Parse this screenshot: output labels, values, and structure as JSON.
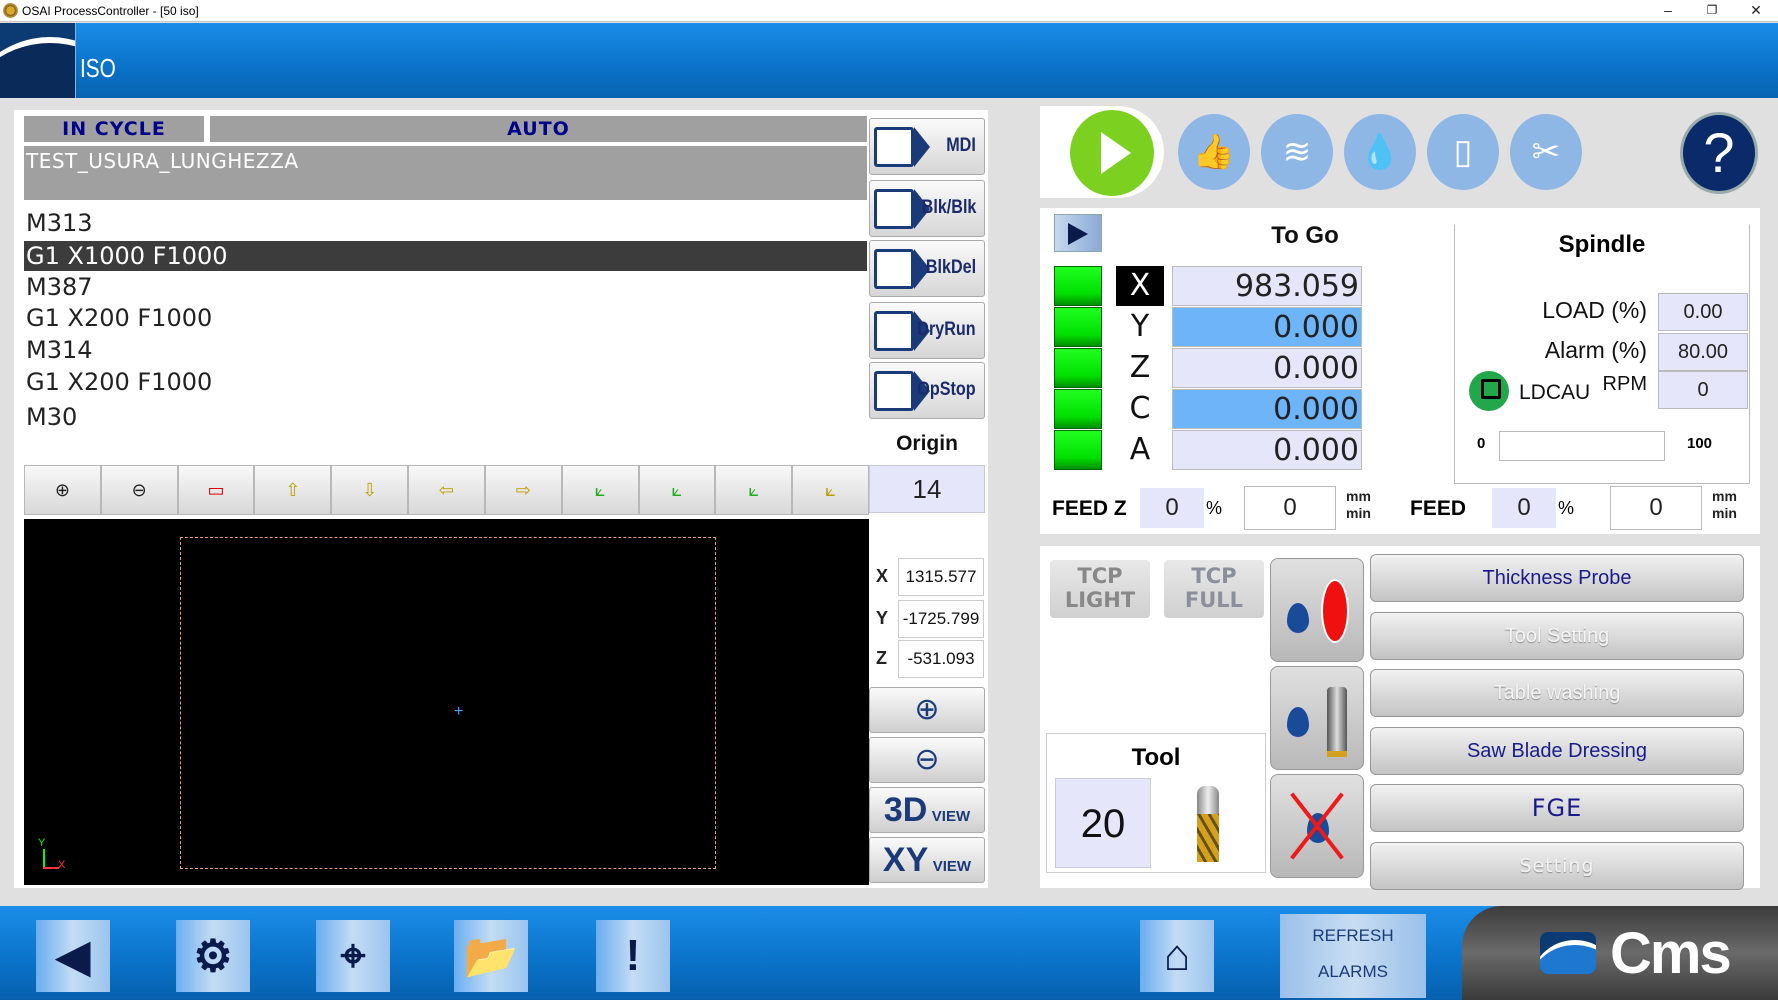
{
  "window": {
    "title": "OSAI ProcessController - [50 iso]",
    "controls": {
      "minimize": "–",
      "restore": "❐",
      "close": "✕"
    }
  },
  "header": {
    "mode_title": "ISO"
  },
  "status": {
    "cycle": "IN CYCLE",
    "mode": "AUTO"
  },
  "program": {
    "name": "TEST_USURA_LUNGHEZZA",
    "lines": [
      "M313",
      "G1 X1000 F1000",
      "M387",
      "G1 X200 F1000",
      "M314",
      "G1 X200 F1000",
      "M30"
    ],
    "selected_index": 1
  },
  "side_commands": [
    {
      "label": "MDI",
      "icon": "hand-icon"
    },
    {
      "label": "Blk/Blk",
      "icon": "block-by-block-icon"
    },
    {
      "label": "BlkDel",
      "icon": "block-delete-icon"
    },
    {
      "label": "DryRun",
      "icon": "dry-run-icon"
    },
    {
      "label": "OpStop",
      "icon": "optional-stop-icon"
    }
  ],
  "origin": {
    "label": "Origin",
    "value": "14"
  },
  "graphic_toolbar": [
    {
      "name": "zoom-in-icon",
      "glyph": "⊕"
    },
    {
      "name": "zoom-out-icon",
      "glyph": "⊖"
    },
    {
      "name": "zoom-window-icon",
      "glyph": "▭"
    },
    {
      "name": "pan-up-icon",
      "glyph": "⇧"
    },
    {
      "name": "pan-down-icon",
      "glyph": "⇩"
    },
    {
      "name": "pan-left-icon",
      "glyph": "⇦"
    },
    {
      "name": "pan-right-icon",
      "glyph": "⇨"
    },
    {
      "name": "view-xy-icon",
      "glyph": "⟀"
    },
    {
      "name": "view-xz-icon",
      "glyph": "⟀"
    },
    {
      "name": "view-yz-icon",
      "glyph": "⟀"
    },
    {
      "name": "view-iso-icon",
      "glyph": "⟀"
    }
  ],
  "graphic": {
    "axis_y": "Y",
    "axis_x": "X",
    "cursor": "+"
  },
  "coords": [
    {
      "axis": "X",
      "value": "1315.577"
    },
    {
      "axis": "Y",
      "value": "-1725.799"
    },
    {
      "axis": "Z",
      "value": "-531.093"
    }
  ],
  "view_buttons": {
    "zoom_in": "⊕",
    "zoom_out": "⊖",
    "view3d_big": "3D",
    "view3d_small": "VIEW",
    "viewxy_big": "XY",
    "viewxy_small": "VIEW"
  },
  "top_icons": {
    "play": "play-icon",
    "items": [
      {
        "name": "thumbs-up-icon",
        "glyph": "👍"
      },
      {
        "name": "air-blow-icon",
        "glyph": "≋"
      },
      {
        "name": "coolant-drop-icon",
        "glyph": "💧"
      },
      {
        "name": "door-icon",
        "glyph": "▯"
      },
      {
        "name": "tools-icon",
        "glyph": "✂"
      }
    ],
    "help": "?"
  },
  "axes": {
    "title": "To Go",
    "rows": [
      {
        "axis": "X",
        "value": "983.059",
        "active": true,
        "highlight": false
      },
      {
        "axis": "Y",
        "value": "0.000",
        "active": false,
        "highlight": true
      },
      {
        "axis": "Z",
        "value": "0.000",
        "active": false,
        "highlight": false
      },
      {
        "axis": "C",
        "value": "0.000",
        "active": false,
        "highlight": true
      },
      {
        "axis": "A",
        "value": "0.000",
        "active": false,
        "highlight": false
      }
    ],
    "status_led_color": "#00e000",
    "highlight_color": "#6eb4f8"
  },
  "spindle": {
    "title": "Spindle",
    "load_label": "LOAD (%)",
    "load_value": "0.00",
    "alarm_label": "Alarm (%)",
    "alarm_value": "80.00",
    "rpm_label": "RPM",
    "rpm_value": "0",
    "ldc_label": "LDCAU",
    "bar_min": "0",
    "bar_max": "100",
    "bar_fraction": 0
  },
  "feed": {
    "feedz_label": "FEED Z",
    "feedz_pct": "0",
    "feedz_value": "0",
    "feed_label": "FEED",
    "feed_pct": "0",
    "feed_value": "0",
    "pct_sym": "%",
    "unit_top": "mm",
    "unit_bottom": "min"
  },
  "tcp": {
    "light_1": "TCP",
    "light_2": "LIGHT",
    "full_1": "TCP",
    "full_2": "FULL"
  },
  "tool": {
    "title": "Tool",
    "number": "20"
  },
  "coolant_buttons": [
    "coolant-saw-blade-icon",
    "coolant-spindle-icon",
    "coolant-off-icon"
  ],
  "menu_buttons": [
    {
      "label": "Thickness Probe",
      "enabled": true
    },
    {
      "label": "Tool Setting",
      "enabled": false
    },
    {
      "label": "Table washing",
      "enabled": false
    },
    {
      "label": "Saw Blade Dressing",
      "enabled": true
    },
    {
      "label": "FGE",
      "enabled": true
    },
    {
      "label": "Setting",
      "enabled": false
    }
  ],
  "footer": {
    "buttons": [
      {
        "name": "back-icon",
        "glyph": "◀"
      },
      {
        "name": "tool-gauge-icon",
        "glyph": "⚙"
      },
      {
        "name": "crosshair-icon",
        "glyph": "⌖"
      },
      {
        "name": "folder-icon",
        "glyph": "📂"
      },
      {
        "name": "alarm-icon",
        "glyph": "!"
      },
      {
        "name": "home-icon",
        "glyph": "⌂"
      }
    ],
    "refresh_1": "REFRESH",
    "refresh_2": "ALARMS",
    "brand": "Cms"
  }
}
